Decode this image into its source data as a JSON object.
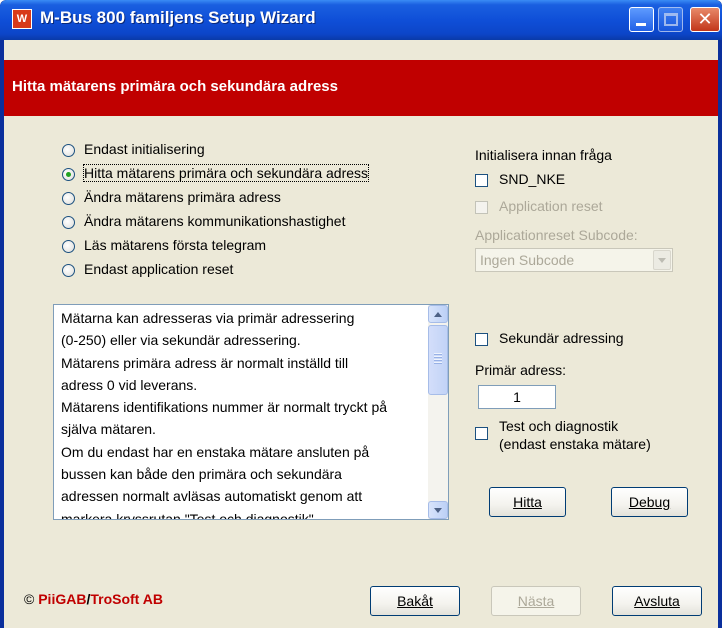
{
  "window": {
    "app_icon_letter": "W",
    "title": "M-Bus 800 familjens Setup Wizard"
  },
  "header": {
    "title": "Hitta mätarens primära och sekundära adress"
  },
  "modes": {
    "selected_index": 1,
    "options": [
      "Endast initialisering",
      "Hitta mätarens primära och sekundära adress",
      "Ändra mätarens primära adress",
      "Ändra mätarens kommunikationshastighet",
      "Läs mätarens första telegram",
      "Endast application reset"
    ]
  },
  "init_panel": {
    "heading": "Initialisera innan fråga",
    "snd_nke_label": "SND_NKE",
    "snd_nke_checked": false,
    "app_reset_label": "Application reset",
    "app_reset_checked": false,
    "subcode_label": "Applicationreset Subcode:",
    "subcode_value": "Ingen Subcode"
  },
  "description": {
    "lines": [
      "Mätarna kan adresseras via primär adressering",
      "(0-250) eller via sekundär adressering.",
      "Mätarens primära adress är normalt inställd till",
      "adress 0 vid leverans.",
      "Mätarens identifikations nummer är normalt tryckt på",
      "själva mätaren.",
      "Om du endast har en enstaka mätare ansluten på",
      "bussen kan både den primära och sekundära",
      "adressen normalt avläsas automatiskt genom att",
      "markera kryssrutan \"Test och diagnostik\"."
    ]
  },
  "address_panel": {
    "secondary_label": "Sekundär adressing",
    "secondary_checked": false,
    "primary_label": "Primär adress:",
    "primary_value": "1",
    "test_label_line1": "Test och diagnostik",
    "test_label_line2": "(endast enstaka mätare)",
    "test_checked": false
  },
  "actions": {
    "find_label": "Hitta",
    "debug_label": "Debug"
  },
  "footer": {
    "copyright_symbol": "©",
    "company1": "PiiGAB",
    "separator": "/",
    "company2": "TroSoft AB",
    "back_label": "Bakåt",
    "next_label": "Nästa",
    "exit_label": "Avsluta"
  },
  "colors": {
    "header_red": "#c00000",
    "titlebar_blue": "#0f4fd8",
    "dialog_bg": "#ece9d8"
  }
}
